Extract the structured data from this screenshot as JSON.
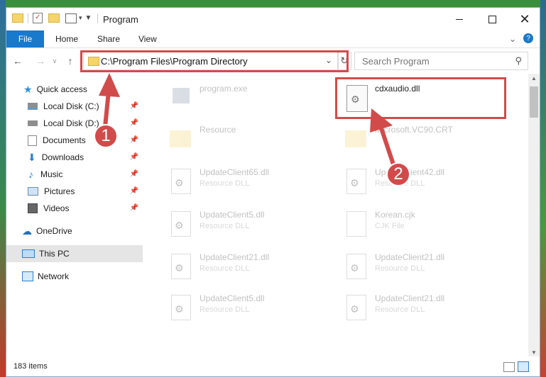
{
  "window": {
    "title": "Program"
  },
  "ribbon": {
    "file": "File",
    "home": "Home",
    "share": "Share",
    "view": "View"
  },
  "address": {
    "path": "C:\\Program Files\\Program Directory"
  },
  "search": {
    "placeholder": "Search Program"
  },
  "sidebar": {
    "items": [
      {
        "label": "Quick access"
      },
      {
        "label": "Local Disk (C:)"
      },
      {
        "label": "Local Disk (D:)"
      },
      {
        "label": "Documents"
      },
      {
        "label": "Downloads"
      },
      {
        "label": "Music"
      },
      {
        "label": "Pictures"
      },
      {
        "label": "Videos"
      },
      {
        "label": "OneDrive"
      },
      {
        "label": "This PC"
      },
      {
        "label": "Network"
      }
    ]
  },
  "files": [
    {
      "name": "program.exe",
      "type": ""
    },
    {
      "name": "cdxaudio.dll",
      "type": ""
    },
    {
      "name": "Resource",
      "type": ""
    },
    {
      "name": "Microsoft.VC90.CRT",
      "type": ""
    },
    {
      "name": "UpdateClient65.dll",
      "type": "Resource DLL"
    },
    {
      "name": "UpdateClient42.dll",
      "type": "Resource DLL"
    },
    {
      "name": "UpdateClient5.dll",
      "type": "Resource DLL"
    },
    {
      "name": "Korean.cjk",
      "type": "CJK File"
    },
    {
      "name": "UpdateClient21.dll",
      "type": "Resource DLL"
    },
    {
      "name": "UpdateClient21.dll",
      "type": "Resource DLL"
    },
    {
      "name": "UpdateClient5.dll",
      "type": "Resource DLL"
    },
    {
      "name": "UpdateClient21.dll",
      "type": "Resource DLL"
    }
  ],
  "status": {
    "items": "183 items"
  },
  "annotations": {
    "step1": "1",
    "step2": "2"
  },
  "colors": {
    "accent": "#1979ca",
    "highlight": "#d24b4b"
  }
}
